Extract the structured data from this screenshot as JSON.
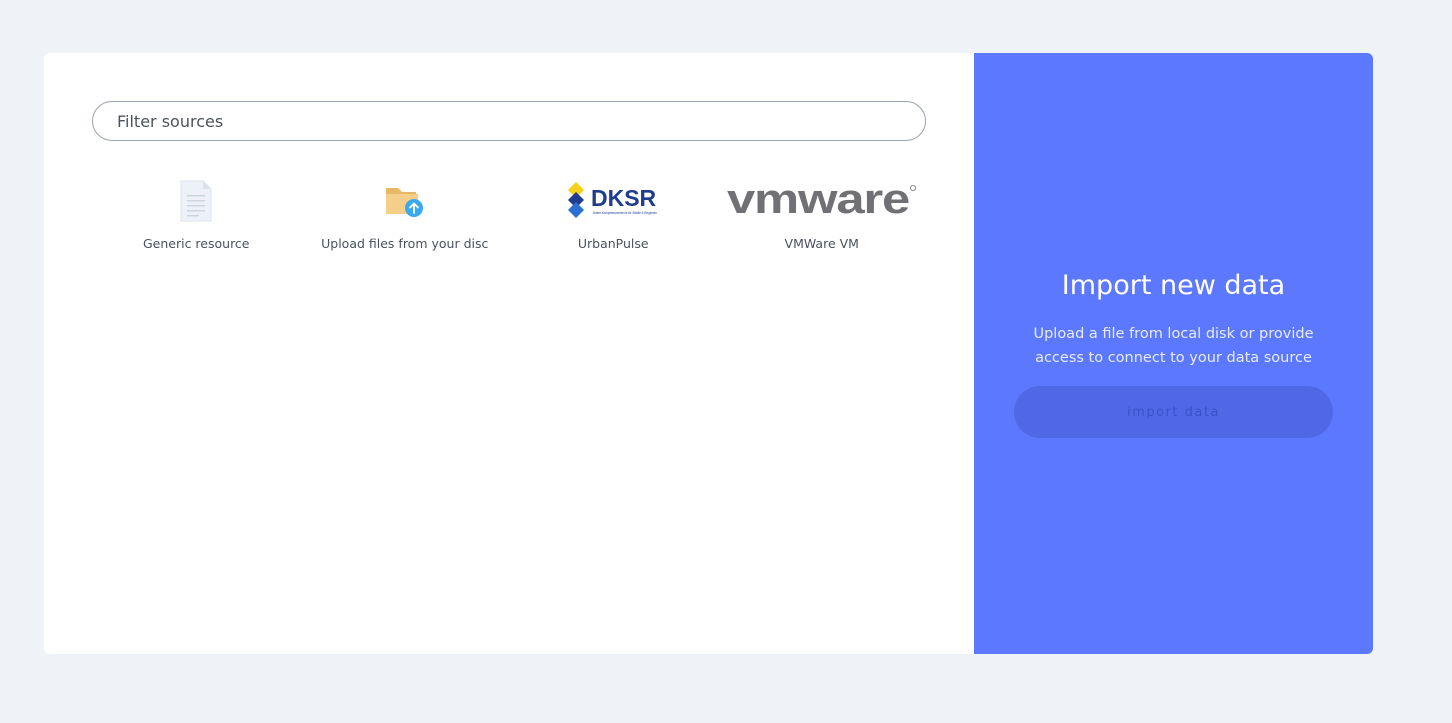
{
  "filter": {
    "placeholder": "Filter sources"
  },
  "sources": [
    {
      "label": "Generic resource",
      "icon": "document-icon"
    },
    {
      "label": "Upload files from your disc",
      "icon": "folder-upload-icon"
    },
    {
      "label": "UrbanPulse",
      "icon": "dksr-logo",
      "logo_text": "DKSR",
      "logo_subtext": "Daten-Kompetenzzentrum für Städte & Regionen"
    },
    {
      "label": "VMWare VM",
      "icon": "vmware-logo",
      "logo_text": "vmware"
    }
  ],
  "import_panel": {
    "title": "Import new data",
    "description": "Upload a file from local disk or provide access to connect to your data source",
    "button_label": "import data"
  },
  "colors": {
    "page_background": "#eff2f7",
    "panel_accent": "#5b78fe",
    "button_background": "#4f69e6",
    "dksr_blue": "#1f3c8f",
    "dksr_yellow": "#f7d117",
    "vmware_gray": "#717074"
  }
}
